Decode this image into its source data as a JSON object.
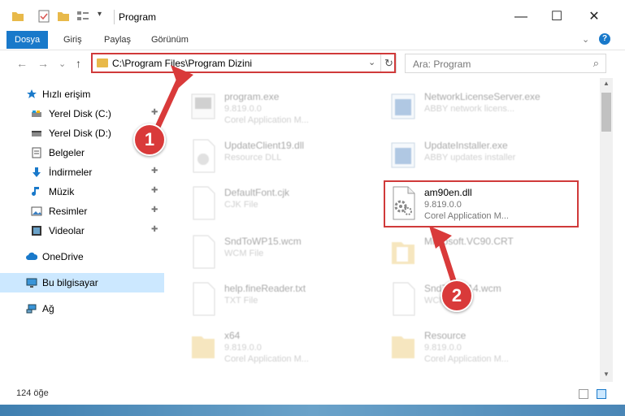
{
  "window": {
    "title": "Program",
    "minimize_glyph": "—",
    "maximize_glyph": "☐",
    "close_glyph": "✕"
  },
  "ribbon": {
    "tabs": [
      "Dosya",
      "Giriş",
      "Paylaş",
      "Görünüm"
    ],
    "expand_glyph": "⌄",
    "help_glyph": "?"
  },
  "nav": {
    "back": "←",
    "forward": "→",
    "recent": "⌄",
    "up": "↑"
  },
  "address": {
    "path": "C:\\Program Files\\Program Dizini",
    "dropdown": "⌄",
    "refresh": "↻"
  },
  "search": {
    "placeholder": "Ara: Program",
    "icon": "⌕"
  },
  "sidebar": {
    "items": [
      {
        "label": "Hızlı erişim",
        "icon": "star-icon",
        "pinned": false
      },
      {
        "label": "Yerel Disk (C:)",
        "icon": "drive-icon",
        "pinned": true
      },
      {
        "label": "Yerel Disk (D:)",
        "icon": "drive-icon",
        "pinned": true
      },
      {
        "label": "Belgeler",
        "icon": "documents-icon",
        "pinned": true
      },
      {
        "label": "İndirmeler",
        "icon": "download-icon",
        "pinned": true
      },
      {
        "label": "Müzik",
        "icon": "music-icon",
        "pinned": true
      },
      {
        "label": "Resimler",
        "icon": "pictures-icon",
        "pinned": true
      },
      {
        "label": "Videolar",
        "icon": "videos-icon",
        "pinned": true
      },
      {
        "label": "OneDrive",
        "icon": "cloud-icon",
        "pinned": false
      },
      {
        "label": "Bu bilgisayar",
        "icon": "computer-icon",
        "pinned": false
      },
      {
        "label": "Ağ",
        "icon": "network-icon",
        "pinned": false
      }
    ],
    "pin_glyph": "📌"
  },
  "files": [
    {
      "name": "program.exe",
      "line2": "9.819.0.0",
      "line3": "Corel Application M...",
      "icon": "exe-icon"
    },
    {
      "name": "NetworkLicenseServer.exe",
      "line2": "ABBY network licens...",
      "line3": "",
      "icon": "exe-icon"
    },
    {
      "name": "UpdateClient19.dll",
      "line2": "Resource DLL",
      "line3": "",
      "icon": "dll-icon"
    },
    {
      "name": "UpdateInstaller.exe",
      "line2": "ABBY updates installer",
      "line3": "",
      "icon": "exe-icon"
    },
    {
      "name": "DefaultFont.cjk",
      "line2": "CJK File",
      "line3": "",
      "icon": "file-icon"
    },
    {
      "name": "am90en.dll",
      "line2": "9.819.0.0",
      "line3": "Corel Application M...",
      "icon": "dll-icon"
    },
    {
      "name": "SndToWP15.wcm",
      "line2": "WCM File",
      "line3": "",
      "icon": "file-icon"
    },
    {
      "name": "Microsoft.VC90.CRT",
      "line2": "",
      "line3": "",
      "icon": "folder-icon"
    },
    {
      "name": "help.fineReader.txt",
      "line2": "TXT File",
      "line3": "",
      "icon": "file-icon"
    },
    {
      "name": "SndToWP14.wcm",
      "line2": "WCM File",
      "line3": "",
      "icon": "file-icon"
    },
    {
      "name": "x64",
      "line2": "9.819.0.0",
      "line3": "Corel Application M...",
      "icon": "folder-icon"
    },
    {
      "name": "Resource",
      "line2": "9.819.0.0",
      "line3": "Corel Application M...",
      "icon": "folder-icon"
    }
  ],
  "status": {
    "item_count": "124 öğe"
  },
  "callouts": [
    "1",
    "2"
  ],
  "colors": {
    "accent": "#1979ca",
    "highlight": "#d03a3a",
    "selected_nav": "#cce8ff"
  }
}
